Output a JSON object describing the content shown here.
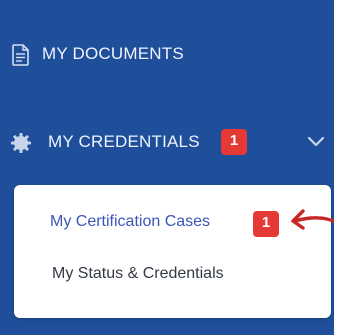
{
  "nav": {
    "documents": {
      "label": "MY DOCUMENTS",
      "icon": "document-icon"
    },
    "credentials": {
      "label": "MY CREDENTIALS",
      "badge": "1",
      "icon": "gear-icon",
      "expand_icon": "chevron-down-icon"
    }
  },
  "submenu": {
    "items": [
      {
        "label": "My Certification Cases",
        "badge": "1"
      },
      {
        "label": "My Status & Credentials"
      }
    ]
  },
  "annotation": {
    "icon": "red-arrow-icon",
    "color": "#c62828"
  },
  "colors": {
    "sidebar_bg": "#1f4f9a",
    "badge_bg": "#e53935",
    "submenu_active_text": "#3a56b6"
  }
}
